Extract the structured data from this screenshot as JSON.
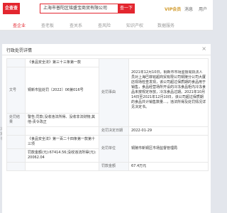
{
  "header": {
    "logo": "企查查",
    "search_value": "上海市普陀区铭盛宝商贸有限公司",
    "search_button": "查一下",
    "vip": "VIP会员",
    "message": "消息",
    "user": "用户"
  },
  "nav": {
    "items": [
      "查企业",
      "查老板",
      "查关系",
      "查风险",
      "知识产权",
      "数据服务"
    ]
  },
  "modal": {
    "title": "行政处罚详情",
    "close": "×",
    "rows": {
      "basis": "《食品安全法》第三十三条第一款",
      "doc_no_label": "文号",
      "doc_no": "铜新市监处罚〔2022〕06第016号",
      "content_label": "处罚事由",
      "content": "2021年12月10日，铜新市市场监督局执法人员对上海巴菲铭超商贸有限公司铜陵分公司大厦店现场检查发现，该公司超过保质期的食品用于销售，食品经营场所开设的冷冻食品柜内冷冻食品未按规定存放，冷冻食品过期。2021年10月14日至2021年12月10日，该公司超过保质期的食品共计销售数量…，违法所得及处罚情况详见决定书。",
      "result_label": "处罚结果",
      "result": "警告;罚款;没收违法所得、没收非法财物;其他-责令改正",
      "date_label": "处罚决定日期",
      "date": "2022-01-29",
      "basis2": "《食品安全法》第一百二十四条第一款第十三项",
      "amount_text": "罚款金额(元):67414.56;没收违法所得(元):20062.04",
      "authority_label": "处罚单位",
      "authority": "铜陵市新铜区市场监督管理局",
      "amount_label": "罚款金额",
      "amount": "67.4万元"
    }
  },
  "side_fragments": [
    "决",
    "定",
    "书"
  ]
}
